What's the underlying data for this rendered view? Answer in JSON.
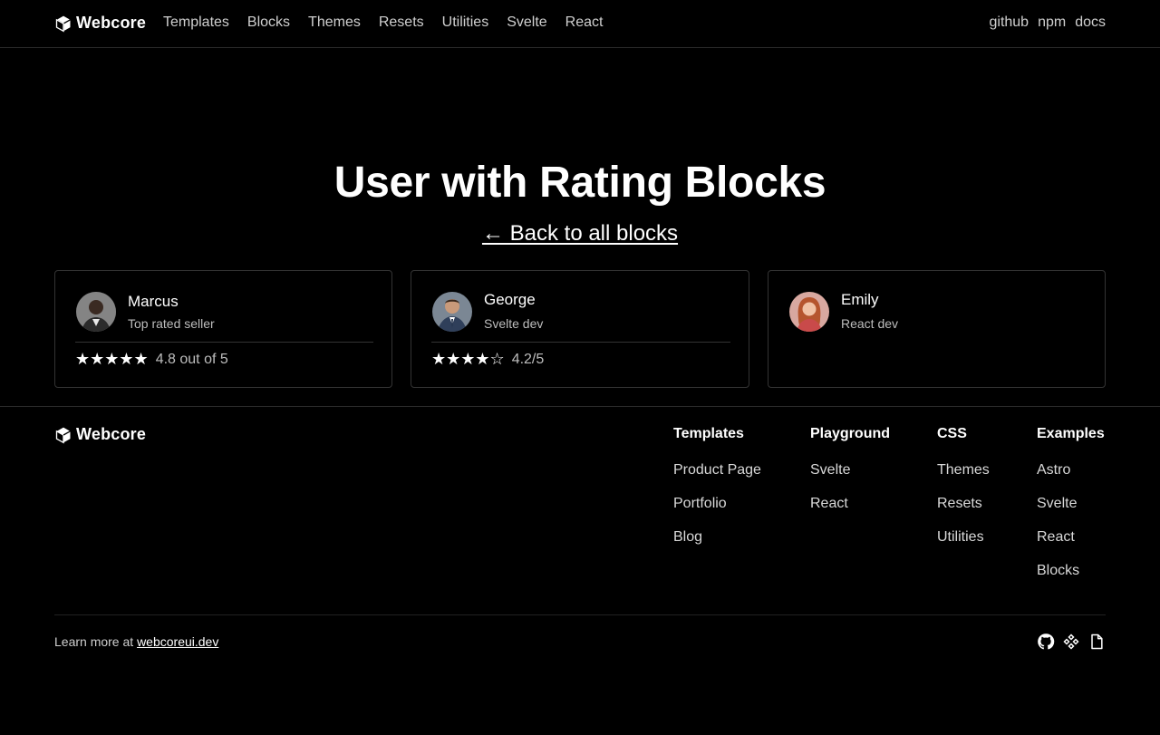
{
  "header": {
    "brand": "Webcore",
    "nav": [
      "Templates",
      "Blocks",
      "Themes",
      "Resets",
      "Utilities",
      "Svelte",
      "React"
    ],
    "nav_right": [
      "github",
      "npm",
      "docs"
    ]
  },
  "hero": {
    "title": "User with Rating Blocks",
    "back_link": "← Back to all blocks"
  },
  "cards": [
    {
      "name": "Marcus",
      "role": "Top rated seller",
      "stars": "★★★★★",
      "rating_text": "4.8 out of 5",
      "rating": 4.8
    },
    {
      "name": "George",
      "role": "Svelte dev",
      "stars": "★★★★☆",
      "rating_text": "4.2/5",
      "rating": 4.2
    },
    {
      "name": "Emily",
      "role": "React dev"
    }
  ],
  "footer": {
    "brand": "Webcore",
    "columns": [
      {
        "title": "Templates",
        "links": [
          "Product Page",
          "Portfolio",
          "Blog"
        ]
      },
      {
        "title": "Playground",
        "links": [
          "Svelte",
          "React"
        ]
      },
      {
        "title": "CSS",
        "links": [
          "Themes",
          "Resets",
          "Utilities"
        ]
      },
      {
        "title": "Examples",
        "links": [
          "Astro",
          "Svelte",
          "React",
          "Blocks"
        ]
      }
    ],
    "learn_prefix": "Learn more at",
    "learn_link": "webcoreui.dev",
    "social_icons": [
      "github-icon",
      "npm-icon",
      "docs-icon"
    ]
  },
  "colors": {
    "background": "#000000",
    "text": "#ffffff",
    "muted": "#bdbdbd",
    "border": "#333333"
  }
}
